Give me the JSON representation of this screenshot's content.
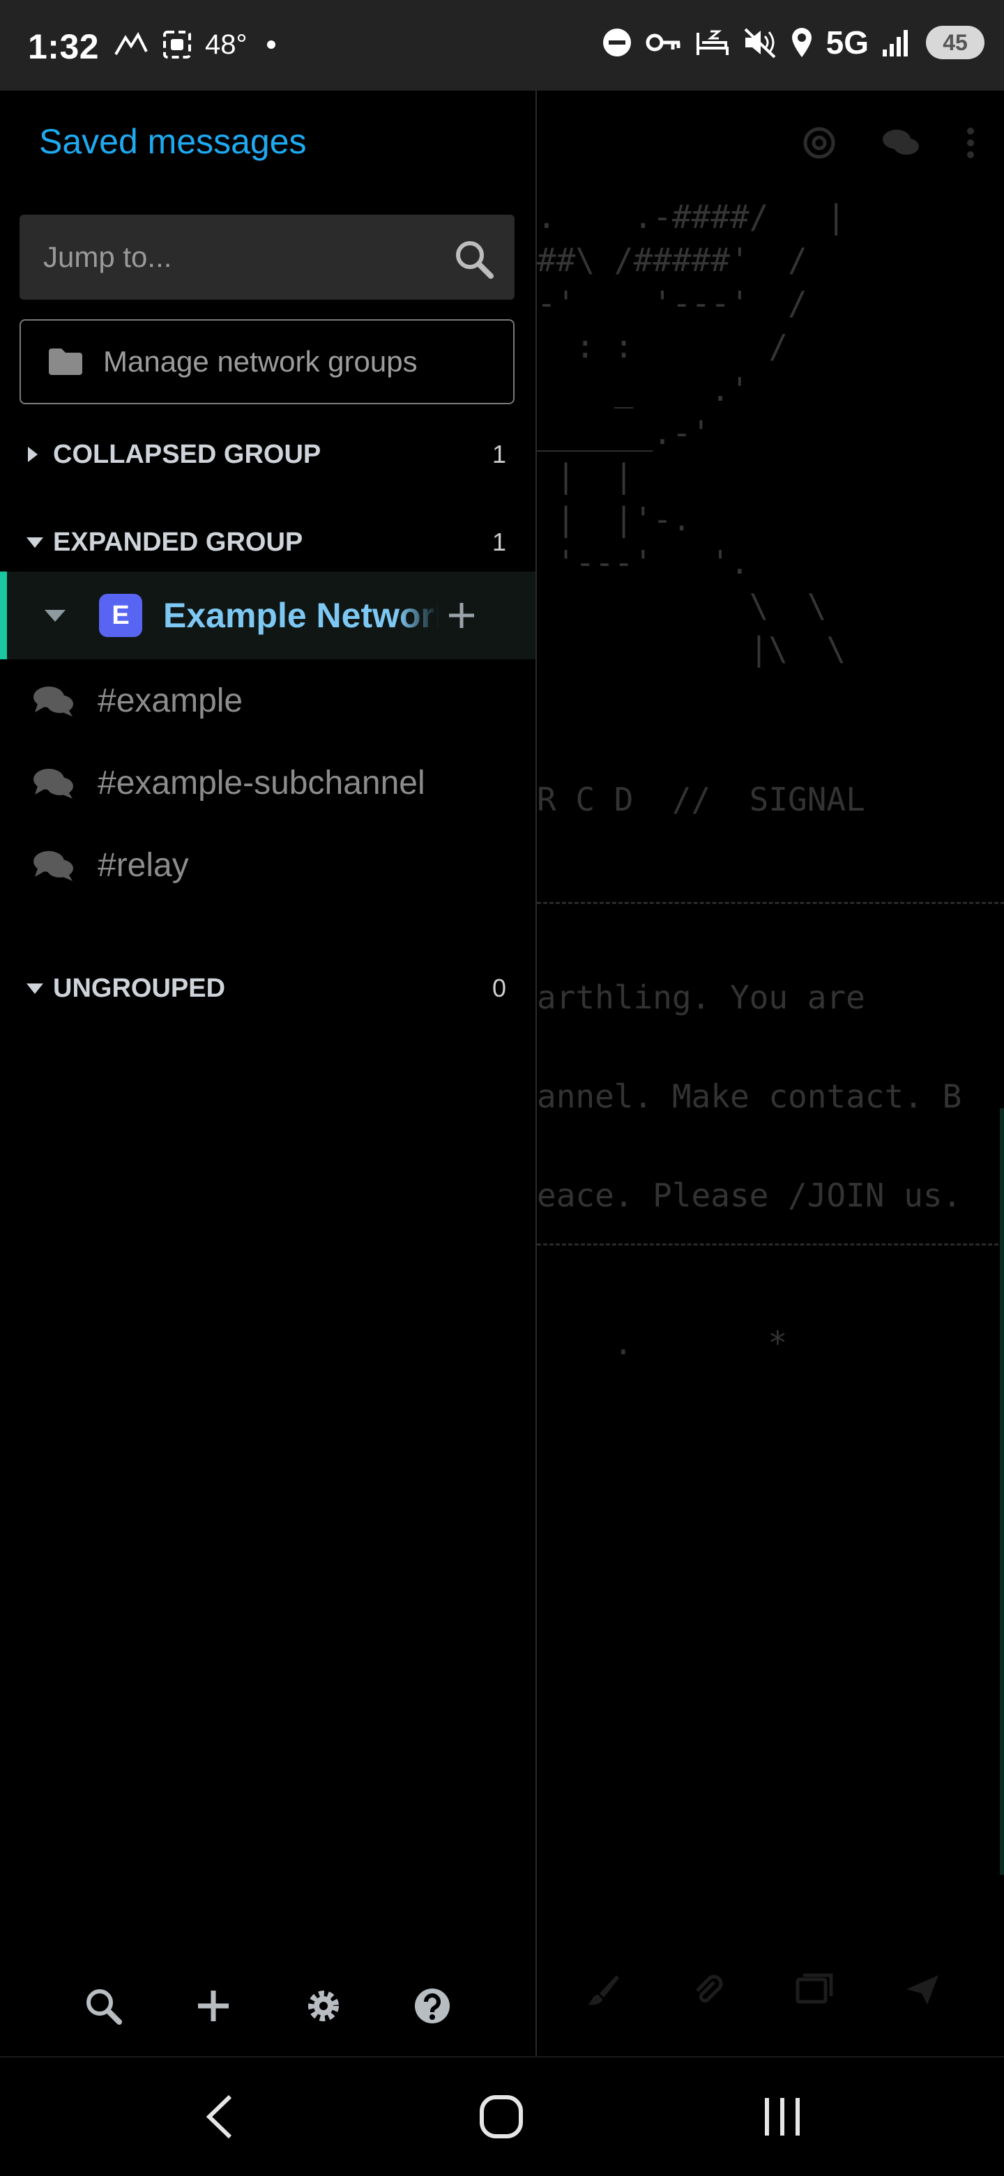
{
  "status_bar": {
    "time": "1:32",
    "temperature": "48°",
    "network": "5G",
    "battery": "45"
  },
  "drawer": {
    "saved_messages": "Saved messages",
    "jump_placeholder": "Jump to...",
    "manage_groups": "Manage network groups",
    "groups": [
      {
        "label": "COLLAPSED GROUP",
        "count": "1",
        "expanded": false
      },
      {
        "label": "EXPANDED GROUP",
        "count": "1",
        "expanded": true
      },
      {
        "label": "UNGROUPED",
        "count": "0",
        "expanded": true
      }
    ],
    "network": {
      "badge": "E",
      "name": "Example Network"
    },
    "channels": [
      "#example",
      "#example-subchannel",
      "#relay"
    ]
  },
  "background_chat": {
    "ascii_art": [
      ".    .-####/   |",
      "##\\ /#####'  /",
      "-'    '---'  /",
      "  : :       /",
      "    _    .'",
      "______.-'",
      " |  |",
      " |  |'-.",
      " '---'   '.",
      "           \\  \\",
      "           |\\  \\"
    ],
    "signal_line": "R C D  //  SIGNAL",
    "lines": [
      "arthling. You are",
      "annel. Make contact. B",
      "eace. Please /JOIN us."
    ],
    "stars": ".       *"
  },
  "colors": {
    "accent_blue": "#1eaaf1",
    "network_badge": "#5865f2",
    "selection_accent": "#19c8a0"
  }
}
